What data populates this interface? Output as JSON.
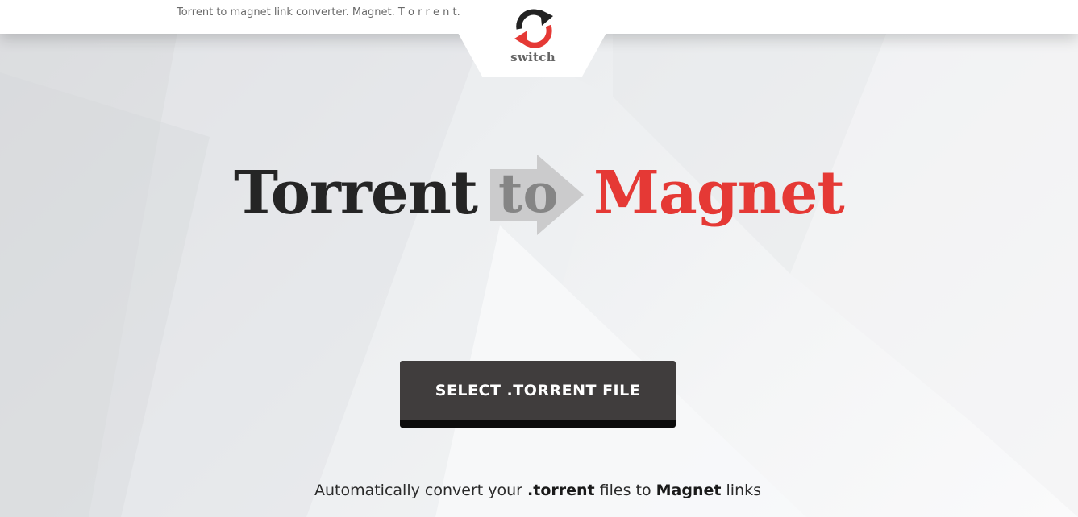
{
  "header": {
    "tagline": "Torrent to magnet link converter. Magnet. T o r r e n t."
  },
  "logo": {
    "icon": "switch-arrows-icon",
    "text": "switch"
  },
  "hero": {
    "word_left": "Torrent",
    "word_middle": "to",
    "word_right": "Magnet",
    "arrow_icon": "right-arrow-icon"
  },
  "action": {
    "select_label": "SELECT .TORRENT FILE"
  },
  "description": {
    "part1": "Automatically convert your ",
    "bold1": ".torrent",
    "part2": " files to ",
    "bold2": "Magnet",
    "part3": " links"
  },
  "colors": {
    "accent_red": "#e53935",
    "dark_text": "#252525",
    "button_bg": "#403d3d",
    "arrow_gray": "#c8c8c8",
    "to_gray": "#858585"
  }
}
